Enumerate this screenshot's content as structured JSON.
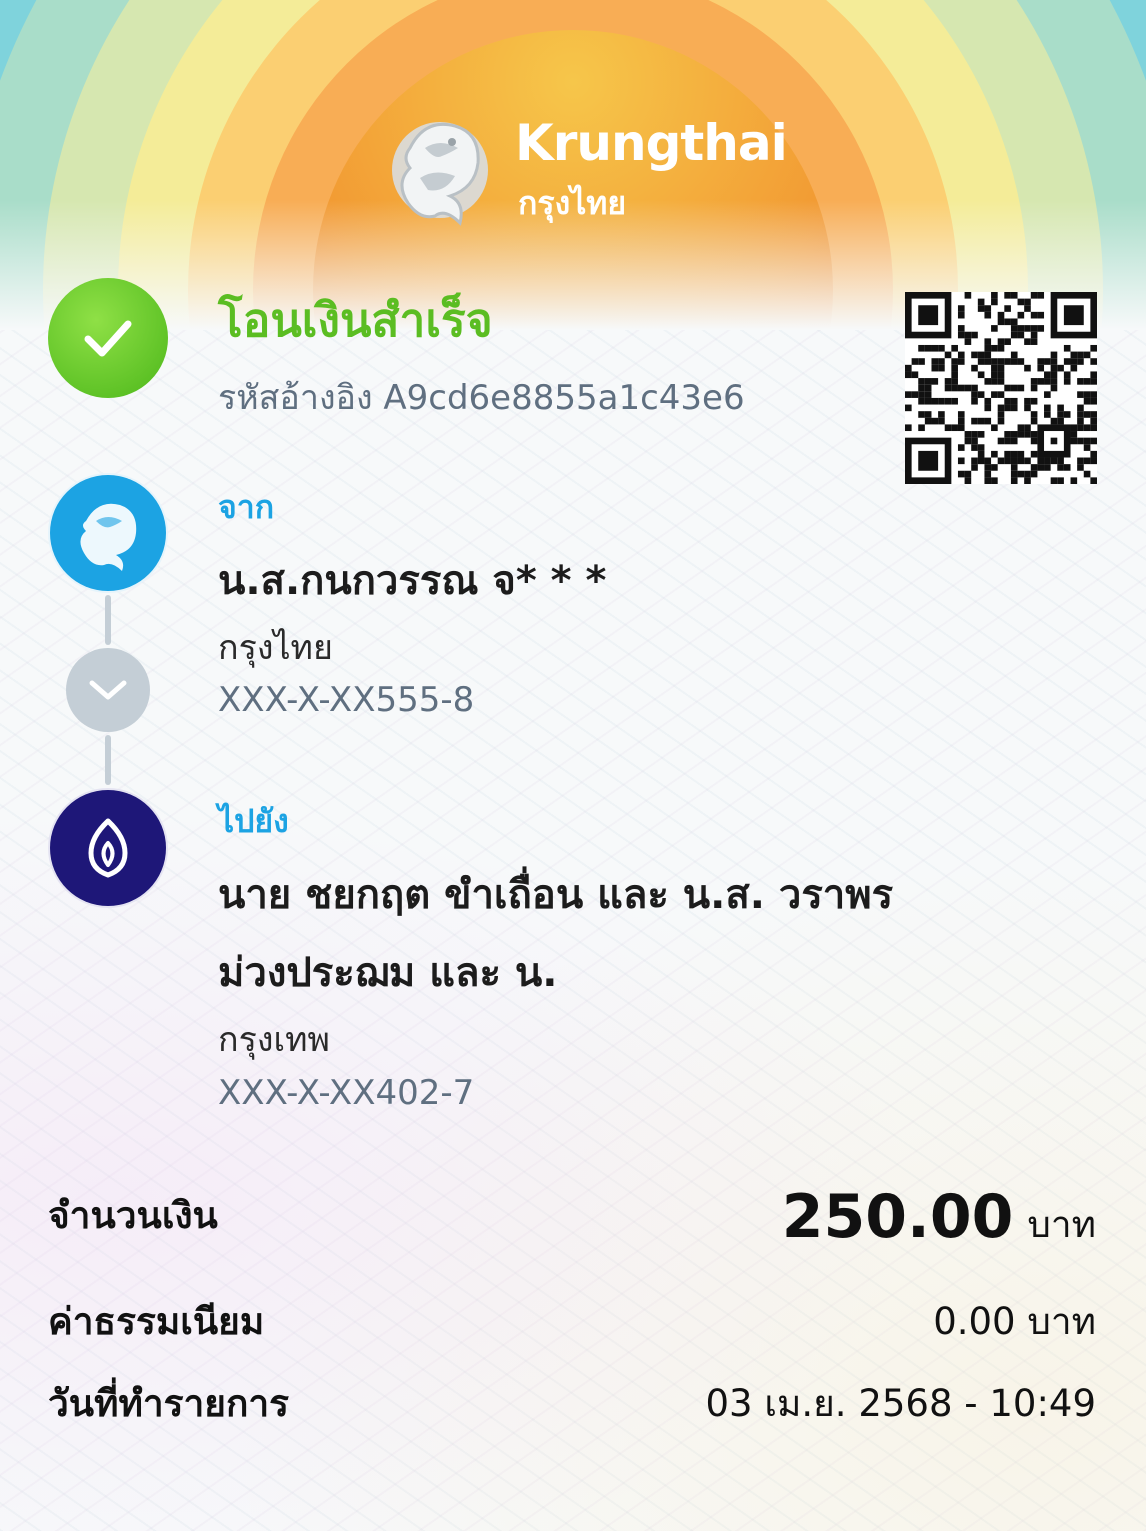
{
  "brand": {
    "name_en": "Krungthai",
    "name_th": "กรุงไทย"
  },
  "status": {
    "title": "โอนเงินสำเร็จ",
    "reference": "รหัสอ้างอิง A9cd6e8855a1c43e6",
    "icon": "checkmark-icon",
    "color": "#5bbd22"
  },
  "from": {
    "label": "จาก",
    "name": "น.ส.กนกวรรณ จ* * *",
    "bank": "กรุงไทย",
    "account": "XXX-X-XX555-8",
    "icon": "krungthai-bank-icon",
    "color": "#1ca3e3"
  },
  "to": {
    "label": "ไปยัง",
    "name_line1": "นาย ชยกฤต ขำเถื่อน และ น.ส. วราพร",
    "name_line2": "ม่วงประฌม และ น.",
    "bank": "กรุงเทพ",
    "account": "XXX-X-XX402-7",
    "icon": "bangkok-bank-icon",
    "color": "#1e1778"
  },
  "details": {
    "amount_label": "จำนวนเงิน",
    "amount_value": "250.00",
    "amount_unit": "บาท",
    "fee_label": "ค่าธรรมเนียม",
    "fee_value": "0.00 บาท",
    "date_label": "วันที่ทำรายการ",
    "date_value": "03 เม.ย. 2568 - 10:49"
  },
  "qr_code": {
    "icon": "qr-code-icon"
  }
}
